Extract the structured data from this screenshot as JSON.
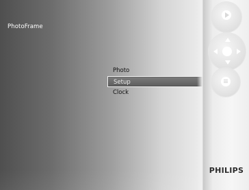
{
  "app": {
    "title": "PhotoFrame"
  },
  "menu": {
    "items": [
      {
        "label": "Photo",
        "selected": false
      },
      {
        "label": "Setup",
        "selected": true
      },
      {
        "label": "Clock",
        "selected": false
      }
    ]
  },
  "sidebar": {
    "buttons": [
      {
        "icon": "play-icon"
      },
      {
        "icon": "navigation-pad-icon"
      },
      {
        "icon": "menu-icon"
      }
    ],
    "brand": "PHILIPS"
  },
  "colors": {
    "selection": "#666666",
    "sidebar": "#f2f2f2",
    "text": "#111111",
    "title_text": "#ffffff"
  }
}
